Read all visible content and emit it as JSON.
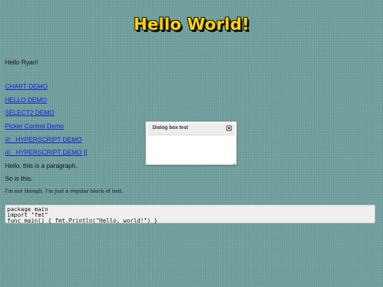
{
  "header": {
    "title": "Hello World!"
  },
  "main": {
    "greeting": "Hello Ryan!",
    "links": [
      {
        "label": "CHART DEMO"
      },
      {
        "label": "HELLO DEMO"
      },
      {
        "label": "SELECT2 DEMO"
      },
      {
        "label": "Picker Control Demo"
      },
      {
        "label": "///_ HYPERSCRIPT DEMO"
      },
      {
        "label": "///_ HYPERSCRIPT DEMO ]["
      }
    ],
    "paragraph_1": "Hello, this is a paragraph.",
    "paragraph_2": "So is this.",
    "small_text": "I'm not though. I'm just a regular block of text.",
    "code": [
      "package main",
      "import \"fmt\"",
      "func main() { fmt.Println(\"Hello, world!\") }"
    ]
  },
  "dialog": {
    "title": "Dialog box test",
    "close_icon": "close-icon",
    "resize_icon": "resize-grip-icon"
  },
  "colors": {
    "background": "#6f9f9d",
    "title_fill": "#ffd400",
    "link": "#0a1dd8"
  }
}
